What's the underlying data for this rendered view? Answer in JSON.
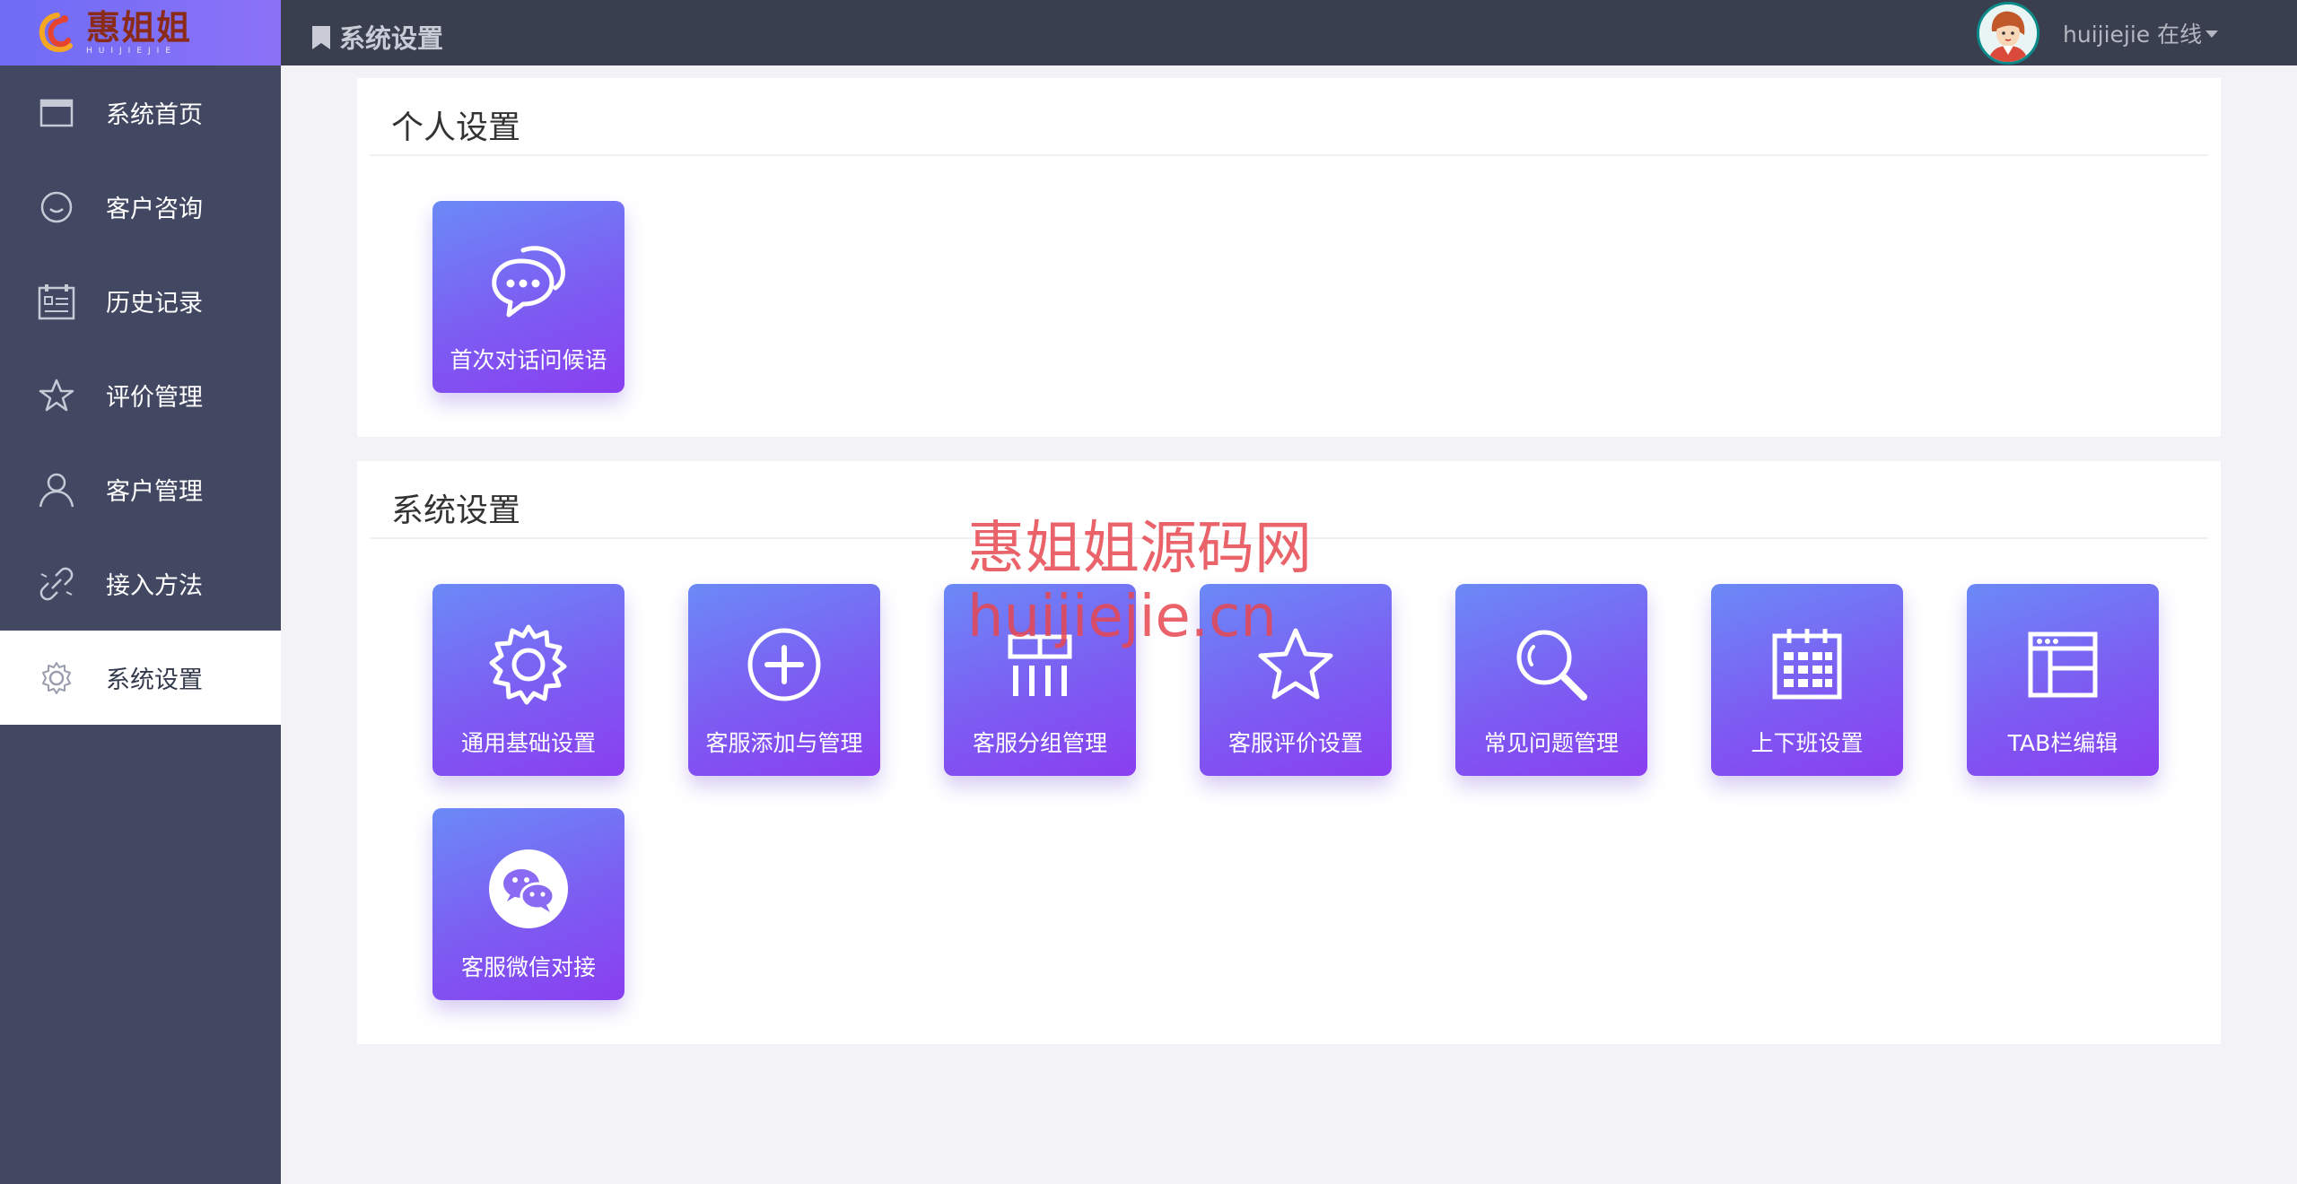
{
  "brand": {
    "name": "惠姐姐",
    "sub": "HUIJIEJIE"
  },
  "sidebar": {
    "items": [
      {
        "label": "系统首页",
        "icon": "window-icon"
      },
      {
        "label": "客户咨询",
        "icon": "chat-bubble-icon"
      },
      {
        "label": "历史记录",
        "icon": "calendar-list-icon"
      },
      {
        "label": "评价管理",
        "icon": "star-icon"
      },
      {
        "label": "客户管理",
        "icon": "user-icon"
      },
      {
        "label": "接入方法",
        "icon": "link-icon"
      },
      {
        "label": "系统设置",
        "icon": "gear-icon",
        "active": true
      }
    ]
  },
  "topbar": {
    "breadcrumb": "系统设置",
    "user": "huijiejie 在线"
  },
  "personal": {
    "title": "个人设置",
    "tiles": [
      {
        "label": "首次对话问候语",
        "icon": "chat-dots-icon"
      }
    ]
  },
  "system": {
    "title": "系统设置",
    "tiles": [
      {
        "label": "通用基础设置",
        "icon": "gear-icon"
      },
      {
        "label": "客服添加与管理",
        "icon": "plus-circle-icon"
      },
      {
        "label": "客服分组管理",
        "icon": "group-icon"
      },
      {
        "label": "客服评价设置",
        "icon": "star-icon"
      },
      {
        "label": "常见问题管理",
        "icon": "search-icon"
      },
      {
        "label": "上下班设置",
        "icon": "calendar-icon"
      },
      {
        "label": "TAB栏编辑",
        "icon": "browser-window-icon"
      },
      {
        "label": "客服微信对接",
        "icon": "wechat-icon"
      }
    ]
  },
  "watermark": {
    "line1": "惠姐姐源码网",
    "line2": "huijiejie.cn"
  },
  "colors": {
    "sidebar": "#424862",
    "topbar": "#3a3f4f",
    "tile_start": "#6b8af7",
    "tile_end": "#8a3ef0"
  }
}
